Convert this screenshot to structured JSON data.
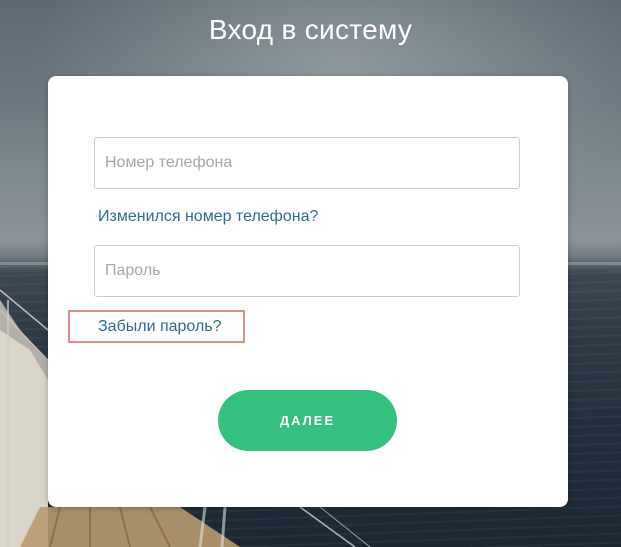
{
  "page": {
    "title": "Вход в систему"
  },
  "form": {
    "phone_placeholder": "Номер телефона",
    "phone_value": "",
    "changed_phone_link": "Изменился номер телефона?",
    "password_placeholder": "Пароль",
    "password_value": "",
    "forgot_password_link": "Забыли пароль?",
    "next_button": "ДАЛЕЕ"
  },
  "colors": {
    "accent_button": "#34c17e",
    "link": "#2f6b8e",
    "highlight_border": "#e58b8b"
  }
}
